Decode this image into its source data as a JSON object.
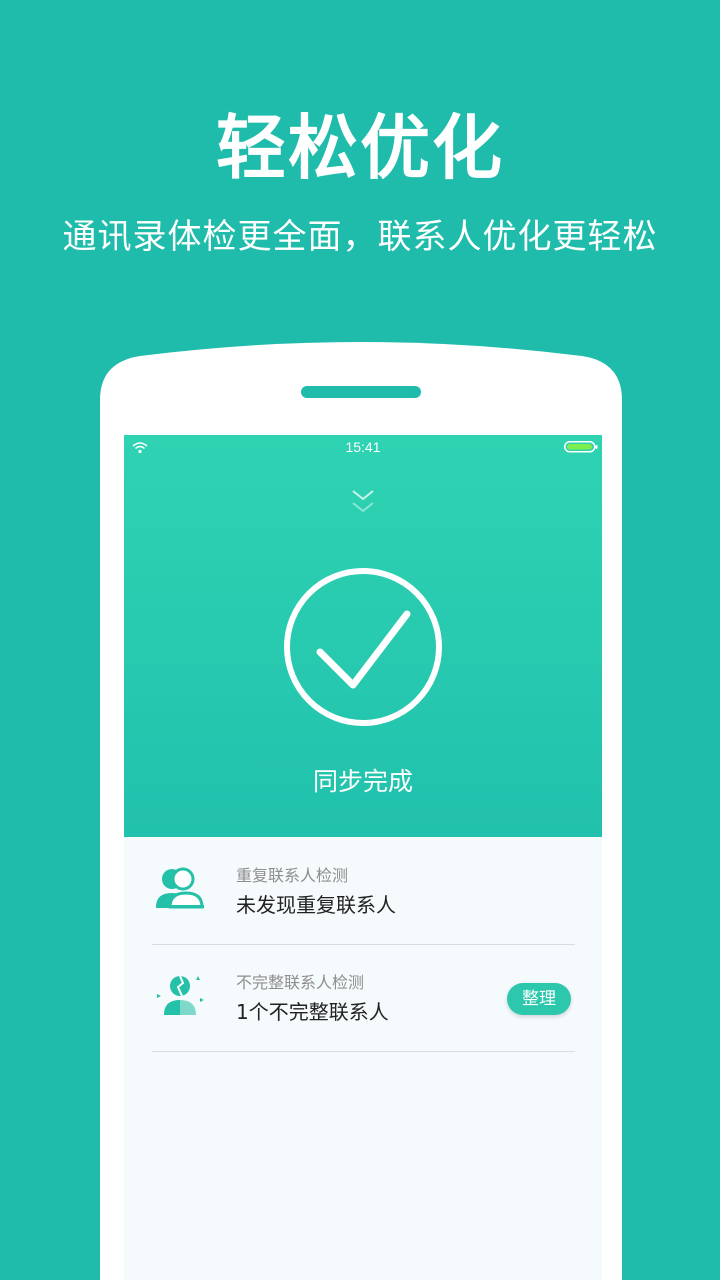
{
  "promo": {
    "headline": "轻松优化",
    "subline": "通讯录体检更全面，联系人优化更轻松"
  },
  "status_bar": {
    "time": "15:41"
  },
  "sync": {
    "status": "同步完成"
  },
  "checks": [
    {
      "caption": "重复联系人检测",
      "value": "未发现重复联系人",
      "icon": "duplicate-contacts-icon"
    },
    {
      "caption": "不完整联系人检测",
      "value": "1个不完整联系人",
      "icon": "incomplete-contact-icon",
      "action": "整理"
    }
  ],
  "colors": {
    "background": "#1fbcac",
    "accent": "#2cc7ad",
    "gradient_top": "#2fd3b2",
    "gradient_bottom": "#21c1ad"
  }
}
